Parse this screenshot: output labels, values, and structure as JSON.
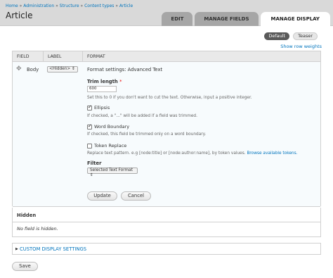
{
  "breadcrumb": {
    "items": [
      "Home",
      "Administration",
      "Structure",
      "Content types",
      "Article"
    ],
    "separator": "»"
  },
  "page_title": "Article",
  "tabs": [
    {
      "label": "EDIT",
      "active": false
    },
    {
      "label": "MANAGE FIELDS",
      "active": false
    },
    {
      "label": "MANAGE DISPLAY",
      "active": true
    }
  ],
  "view_modes": {
    "default": "Default",
    "teaser": "Teaser"
  },
  "row_weights_link": "Show row weights",
  "table": {
    "headers": {
      "field": "FIELD",
      "label": "LABEL",
      "format": "FORMAT"
    },
    "row": {
      "field": "Body",
      "label_value": "<Hidden>",
      "format_settings_title": "Format settings: Advanced Text"
    }
  },
  "settings": {
    "trim_length_label": "Trim length",
    "required_marker": "*",
    "trim_length_value": "600",
    "trim_length_help": "Set this to 0 if you don't want to cut the text. Otherwise, input a positive integer.",
    "ellipsis_label": "Ellipsis",
    "ellipsis_checked": true,
    "ellipsis_help": "If checked, a \"...\" will be added if a field was trimmed.",
    "word_boundary_label": "Word Boundary",
    "word_boundary_checked": true,
    "word_boundary_help": "If checked, this field be trimmed only on a word boundary.",
    "token_replace_label": "Token Replace",
    "token_replace_checked": false,
    "token_replace_help": "Replace text pattern. e.g [node:title] or [node:author:name], by token values.",
    "token_replace_link": "Browse available tokens.",
    "filter_label": "Filter",
    "filter_value": "Selected Text Format",
    "update_button": "Update",
    "cancel_button": "Cancel"
  },
  "hidden_region": {
    "title": "Hidden",
    "empty_text": "No field is hidden."
  },
  "custom_display_settings": "CUSTOM DISPLAY SETTINGS",
  "save_button": "Save"
}
